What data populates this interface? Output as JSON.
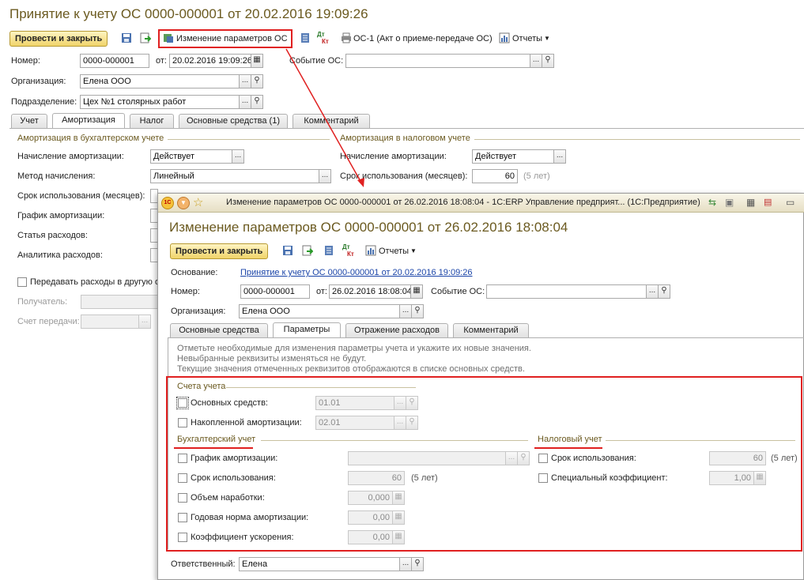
{
  "main": {
    "title": "Принятие к учету ОС 0000-000001 от 20.02.2016 19:09:26",
    "toolbar": {
      "post_close": "Провести и закрыть",
      "change_params": "Изменение параметров ОС",
      "dt_kt_top": "Дт",
      "dt_kt_bottom": "Кт",
      "print_os1": "ОС-1 (Акт о приеме-передаче ОС)",
      "reports": "Отчеты"
    },
    "number_label": "Номер:",
    "number_value": "0000-000001",
    "from_label": "от:",
    "date_value": "20.02.2016 19:09:26",
    "event_label": "Событие ОС:",
    "event_value": "",
    "org_label": "Организация:",
    "org_value": "Елена ООО",
    "dept_label": "Подразделение:",
    "dept_value": "Цех №1 столярных работ",
    "tabs": [
      "Учет",
      "Амортизация",
      "Налог",
      "Основные средства (1)",
      "Комментарий"
    ],
    "accounting_group": "Амортизация в бухгалтерском учете",
    "tax_group": "Амортизация в налоговом учете",
    "amort_charge_label": "Начисление амортизации:",
    "amort_charge_value": "Действует",
    "method_label": "Метод начисления:",
    "method_value": "Линейный",
    "useful_life_label": "Срок использования (месяцев):",
    "schedule_label": "График амортизации:",
    "expense_item_label": "Статья расходов:",
    "analytics_label": "Аналитика расходов:",
    "transfer_expenses_label": "Передавать расходы в другую о",
    "recipient_label": "Получатель:",
    "transfer_account_label": "Счет передачи:",
    "tax_amort_charge_label": "Начисление амортизации:",
    "tax_amort_charge_value": "Действует",
    "tax_useful_life_label": "Срок использования (месяцев):",
    "tax_useful_life_value": "60",
    "tax_useful_life_years": "(5 лет)"
  },
  "dialog": {
    "window_title": "Изменение параметров ОС 0000-000001 от 26.02.2016 18:08:04 - 1С:ERP Управление предприят... (1С:Предприятие)",
    "title": "Изменение параметров ОС 0000-000001 от 26.02.2016 18:08:04",
    "toolbar": {
      "post_close": "Провести и закрыть",
      "dt_kt_top": "Дт",
      "dt_kt_bottom": "Кт",
      "reports": "Отчеты"
    },
    "basis_label": "Основание:",
    "basis_link": "Принятие к учету ОС 0000-000001 от 20.02.2016 19:09:26",
    "number_label": "Номер:",
    "number_value": "0000-000001",
    "from_label": "от:",
    "date_value": "26.02.2016 18:08:04",
    "event_label": "Событие ОС:",
    "event_value": "",
    "org_label": "Организация:",
    "org_value": "Елена ООО",
    "tabs": [
      "Основные средства",
      "Параметры",
      "Отражение расходов",
      "Комментарий"
    ],
    "hint1": "Отметьте необходимые для изменения параметры учета и укажите их новые значения.",
    "hint2": "Невыбранные реквизиты изменяться не будут.",
    "hint3": "Текущие значения отмеченных реквизитов отображаются в списке основных средств.",
    "accounts_group": "Счета учета",
    "fixed_assets_label": "Основных средств:",
    "fixed_assets_value": "01.01",
    "accum_amort_label": "Накопленной амортизации:",
    "accum_amort_value": "02.01",
    "accounting_group": "Бухгалтерский учет",
    "tax_group": "Налоговый учет",
    "schedule_label": "График амортизации:",
    "schedule_value": "",
    "useful_life_label": "Срок использования:",
    "useful_life_value": "60",
    "useful_life_years": "(5 лет)",
    "output_volume_label": "Объем наработки:",
    "output_volume_value": "0,000",
    "annual_rate_label": "Годовая норма амортизации:",
    "annual_rate_value": "0,00",
    "accel_coef_label": "Коэффициент ускорения:",
    "accel_coef_value": "0,00",
    "tax_useful_life_label": "Срок использования:",
    "tax_useful_life_value": "60",
    "tax_useful_life_years": "(5 лет)",
    "special_coef_label": "Специальный коэффициент:",
    "special_coef_value": "1,00",
    "responsible_label": "Ответственный:",
    "responsible_value": "Елена"
  },
  "colors": {
    "title": "#6b5a20",
    "highlight_red": "#e02020",
    "button_yellow": "#f0d46a",
    "link_blue": "#1a44a8"
  }
}
